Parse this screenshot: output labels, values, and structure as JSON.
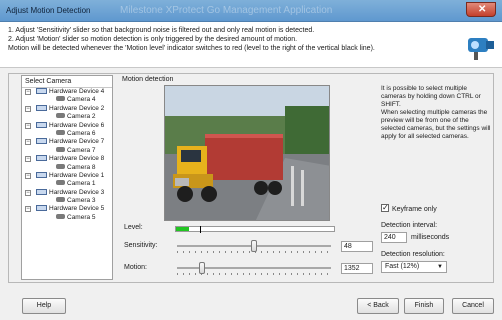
{
  "window": {
    "title": "Adjust Motion Detection",
    "ghost_title": "Milestone XProtect Go Management Application"
  },
  "instructions": [
    "1. Adjust 'Sensitivity' slider so that background noise is filtered out and only real motion is detected.",
    "2. Adjust 'Motion' slider so motion detection is only triggered by the desired amount of motion.",
    "Motion will be detected whenever the 'Motion level' indicator switches to red (level to the right of the vertical black line)."
  ],
  "camera_tree": {
    "header": "Select Camera",
    "items": [
      {
        "device": "Hardware Device 4",
        "camera": "Camera 4"
      },
      {
        "device": "Hardware Device 2",
        "camera": "Camera 2"
      },
      {
        "device": "Hardware Device 6",
        "camera": "Camera 6"
      },
      {
        "device": "Hardware Device 7",
        "camera": "Camera 7"
      },
      {
        "device": "Hardware Device 8",
        "camera": "Camera 8"
      },
      {
        "device": "Hardware Device 1",
        "camera": "Camera 1"
      },
      {
        "device": "Hardware Device 3",
        "camera": "Camera 3"
      },
      {
        "device": "Hardware Device 5",
        "camera": "Camera 5"
      }
    ]
  },
  "motion": {
    "section_label": "Motion detection",
    "level_label": "Level:",
    "level_fraction": 0.08,
    "threshold_fraction": 0.15,
    "sensitivity_label": "Sensitivity:",
    "sensitivity_value": "48",
    "sensitivity_fraction": 0.5,
    "motion_label": "Motion:",
    "motion_value": "1352",
    "motion_fraction": 0.16
  },
  "info": {
    "text1": "It is possible to select multiple cameras by holding down CTRL or SHIFT.",
    "text2": "When selecting multiple cameras the preview will be from one of the selected cameras, but the settings will apply for all selected cameras."
  },
  "settings": {
    "keyframe_label": "Keyframe only",
    "interval_label": "Detection interval:",
    "interval_value": "240",
    "interval_unit": "milliseconds",
    "resolution_label": "Detection resolution:",
    "resolution_value": "Fast (12%)"
  },
  "buttons": {
    "help": "Help",
    "back": "< Back",
    "finish": "Finish",
    "cancel": "Cancel"
  },
  "colors": {
    "level_fill": "#21c521",
    "titlebar": "#6fa3d5"
  }
}
